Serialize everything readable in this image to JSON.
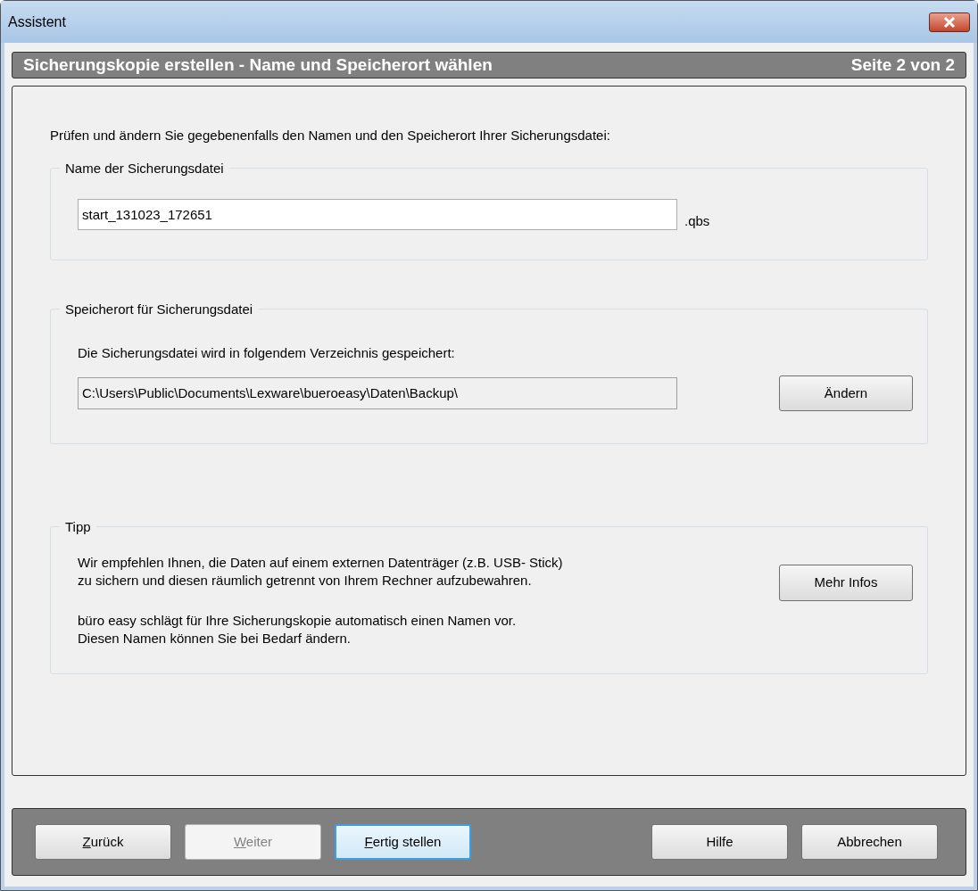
{
  "window": {
    "title": "Assistent"
  },
  "header": {
    "title": "Sicherungskopie erstellen - Name und Speicherort wählen",
    "page": "Seite 2 von 2"
  },
  "intro": "Prüfen und ändern Sie gegebenenfalls den Namen und den Speicherort Ihrer Sicherungsdatei:",
  "name_group": {
    "title": "Name der Sicherungsdatei",
    "value": "start_131023_172651",
    "extension": ".qbs"
  },
  "location_group": {
    "title": "Speicherort für Sicherungsdatei",
    "description": "Die Sicherungsdatei wird in folgendem Verzeichnis gespeichert:",
    "path": "C:\\Users\\Public\\Documents\\Lexware\\bueroeasy\\Daten\\Backup\\",
    "button": "Ändern"
  },
  "tip_group": {
    "title": "Tipp",
    "lines": [
      "Wir empfehlen Ihnen, die Daten auf einem externen Datenträger (z.B. USB- Stick)",
      "zu sichern und diesen räumlich getrennt von Ihrem Rechner aufzubewahren."
    ],
    "note_lines": [
      "büro easy schlägt für Ihre Sicherungskopie automatisch einen Namen vor.",
      "Diesen Namen können Sie bei Bedarf ändern."
    ],
    "button": "Mehr Infos"
  },
  "footer_buttons": [
    {
      "label": "Zurück",
      "mnemonic_underlined": true,
      "disabled": false,
      "focused": false
    },
    {
      "label": "Weiter",
      "mnemonic_underlined": true,
      "disabled": true,
      "focused": false
    },
    {
      "label": "Fertig stellen",
      "mnemonic_underlined": true,
      "disabled": false,
      "focused": true
    },
    {
      "label": "Hilfe",
      "mnemonic_underlined": false,
      "disabled": false,
      "focused": false
    },
    {
      "label": "Abbrechen",
      "mnemonic_underlined": false,
      "disabled": false,
      "focused": false
    }
  ]
}
